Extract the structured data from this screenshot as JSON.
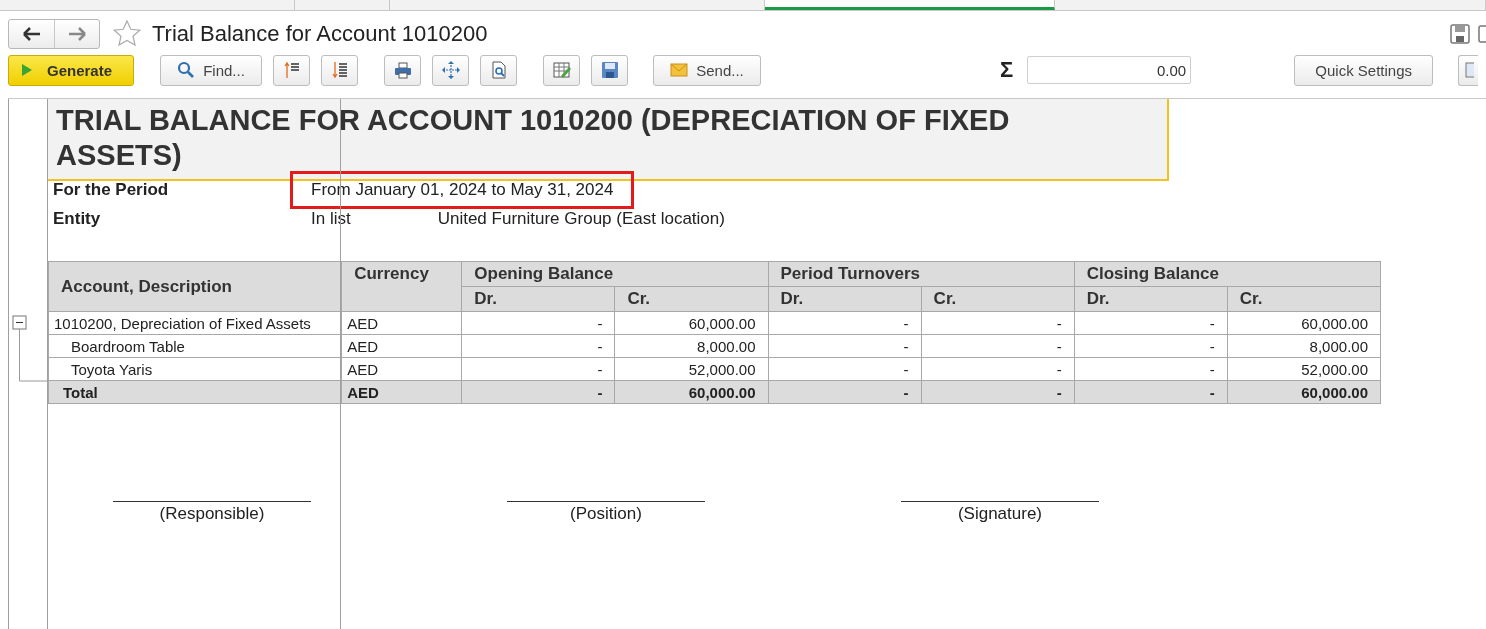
{
  "top_tabs": [
    {
      "selected": false
    },
    {
      "selected": false
    },
    {
      "selected": false
    },
    {
      "selected": true
    },
    {
      "selected": false
    }
  ],
  "header": {
    "title": "Trial Balance for Account 1010200",
    "favorite": false
  },
  "toolbar": {
    "generate": "Generate",
    "find": "Find...",
    "send": "Send...",
    "sum_symbol": "Σ",
    "sum_value": "0.00",
    "quick_settings": "Quick Settings"
  },
  "report": {
    "title": "TRIAL BALANCE FOR ACCOUNT 1010200 (DEPRECIATION OF FIXED ASSETS)",
    "params": [
      {
        "label": "For the Period",
        "value": "From January 01, 2024 to May 31, 2024",
        "highlighted": true
      },
      {
        "label": "Entity",
        "value": "In list",
        "extra": "United Furniture Group (East location)",
        "highlighted": false
      }
    ],
    "columns": {
      "account": "Account, Description",
      "currency": "Currency",
      "groups": [
        "Opening Balance",
        "Period Turnovers",
        "Closing Balance"
      ],
      "sub": [
        "Dr.",
        "Cr.",
        "Dr.",
        "Cr.",
        "Dr.",
        "Cr."
      ]
    },
    "rows": [
      {
        "account": "1010200, Depreciation of Fixed Assets",
        "currency": "AED",
        "values": [
          "-",
          "60,000.00",
          "-",
          "-",
          "-",
          "60,000.00"
        ],
        "expanded": true,
        "children": [
          {
            "account": "Boardroom Table",
            "currency": "AED",
            "values": [
              "-",
              "8,000.00",
              "-",
              "-",
              "-",
              "8,000.00"
            ]
          },
          {
            "account": "Toyota Yaris",
            "currency": "AED",
            "values": [
              "-",
              "52,000.00",
              "-",
              "-",
              "-",
              "52,000.00"
            ]
          }
        ]
      }
    ],
    "total": {
      "label": "Total",
      "currency": "AED",
      "values": [
        "-",
        "60,000.00",
        "-",
        "-",
        "-",
        "60,000.00"
      ]
    },
    "signatures": [
      "(Responsible)",
      "(Position)",
      "(Signature)"
    ]
  }
}
